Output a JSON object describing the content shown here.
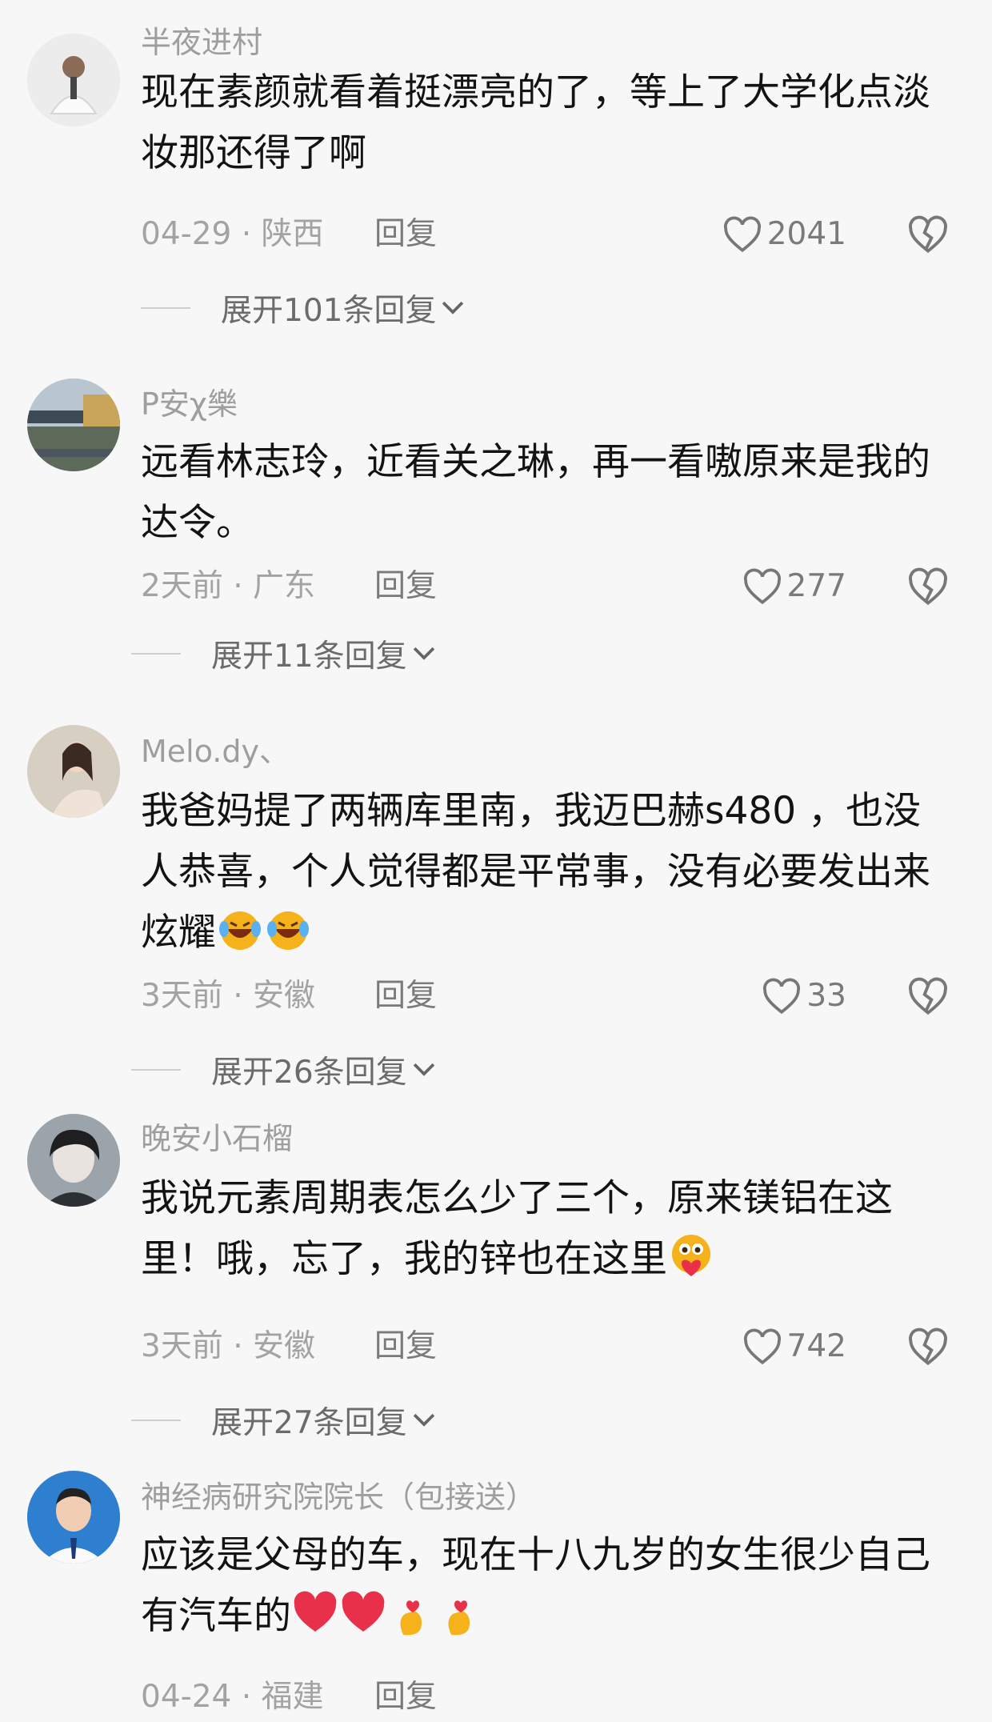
{
  "comments": [
    {
      "username": "半夜进村",
      "content": "现在素颜就看着挺漂亮的了，等上了大学化点淡妆那还得了啊",
      "date": "04-29 · 陕西",
      "reply": "回复",
      "likes": "2041",
      "expand": "展开101条回复"
    },
    {
      "username": "P安χ樂",
      "content": "远看林志玲，近看关之琳，再一看嗷原来是我的达令。",
      "date": "2天前 · 广东",
      "reply": "回复",
      "likes": "277",
      "expand": "展开11条回复"
    },
    {
      "username": "Melo.dy、",
      "content": "我爸妈提了两辆库里南，我迈巴赫s480 ，也没人恭喜，个人觉得都是平常事，没有必要发出来炫耀",
      "date": "3天前 · 安徽",
      "reply": "回复",
      "likes": "33",
      "expand": "展开26条回复",
      "emojis": [
        "laughing-crying-emoji",
        "laughing-crying-emoji"
      ]
    },
    {
      "username": "晚安小石榴",
      "content": "我说元素周期表怎么少了三个，原来镁铝在这里！哦，忘了，我的锌也在这里",
      "date": "3天前 · 安徽",
      "reply": "回复",
      "likes": "742",
      "expand": "展开27条回复",
      "emojis": [
        "heart-hold-emoji"
      ]
    },
    {
      "username": "神经病研究院院长（包接送）",
      "content": "应该是父母的车，现在十八九岁的女生很少自己有汽车的",
      "date": "04-24 · 福建",
      "reply": "回复",
      "emojis": [
        "red-heart-emoji",
        "red-heart-emoji",
        "finger-heart-emoji",
        "finger-heart-emoji"
      ]
    }
  ],
  "colors": {
    "background": "#f7f7f7",
    "text": "#131313",
    "meta": "#a3a3a3",
    "heart_red": "#e8304a",
    "gold": "#f5b21b"
  },
  "icons": [
    "heart-outline-icon",
    "dislike-broken-heart-icon",
    "chevron-down-icon"
  ]
}
